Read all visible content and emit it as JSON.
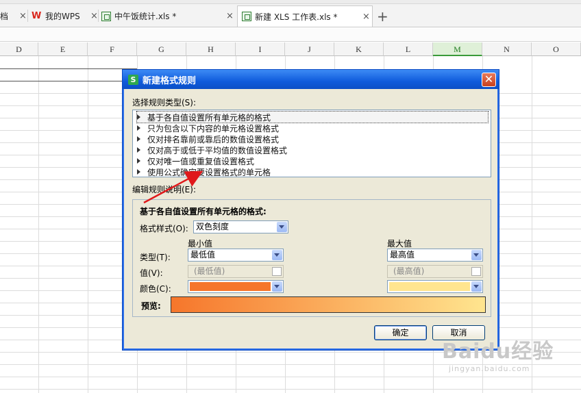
{
  "tabs": [
    {
      "label": "我的WPS",
      "closable": true
    },
    {
      "label": "中午饭统计.xls *",
      "closable": true
    },
    {
      "label": "新建 XLS 工作表.xls *",
      "closable": true,
      "active": true
    }
  ],
  "tab_partial_left": "档",
  "new_tab_symbol": "+",
  "close_symbol": "×",
  "columns": [
    "D",
    "E",
    "F",
    "G",
    "H",
    "I",
    "J",
    "K",
    "L",
    "M",
    "N",
    "O"
  ],
  "selected_column": "M",
  "dialog": {
    "title": "新建格式规则",
    "icon_letter": "S",
    "rule_type_label": "选择规则类型(S):",
    "rule_types": [
      "基于各自值设置所有单元格的格式",
      "只为包含以下内容的单元格设置格式",
      "仅对排名靠前或靠后的数值设置格式",
      "仅对高于或低于平均值的数值设置格式",
      "仅对唯一值或重复值设置格式",
      "使用公式确定要设置格式的单元格"
    ],
    "selected_rule_index": 0,
    "edit_label": "编辑规则说明(E):",
    "group_title": "基于各自值设置所有单元格的格式:",
    "format_style_label": "格式样式(O):",
    "format_style_value": "双色刻度",
    "min_header": "最小值",
    "max_header": "最大值",
    "type_label": "类型(T):",
    "value_label": "值(V):",
    "color_label": "颜色(C):",
    "min_type": "最低值",
    "max_type": "最高值",
    "min_value": "(最低值)",
    "max_value": "(最高值)",
    "min_color": "#f6762b",
    "max_color": "#ffe58f",
    "preview_label": "预览:",
    "ok_label": "确定",
    "cancel_label": "取消"
  },
  "watermark": {
    "main": "Baidu经验",
    "sub": "jingyan.baidu.com"
  },
  "colors": {
    "titlebar": "#0f5bdc",
    "dialog_bg": "#ece9d8",
    "annotation_arrow": "#e0191b"
  }
}
